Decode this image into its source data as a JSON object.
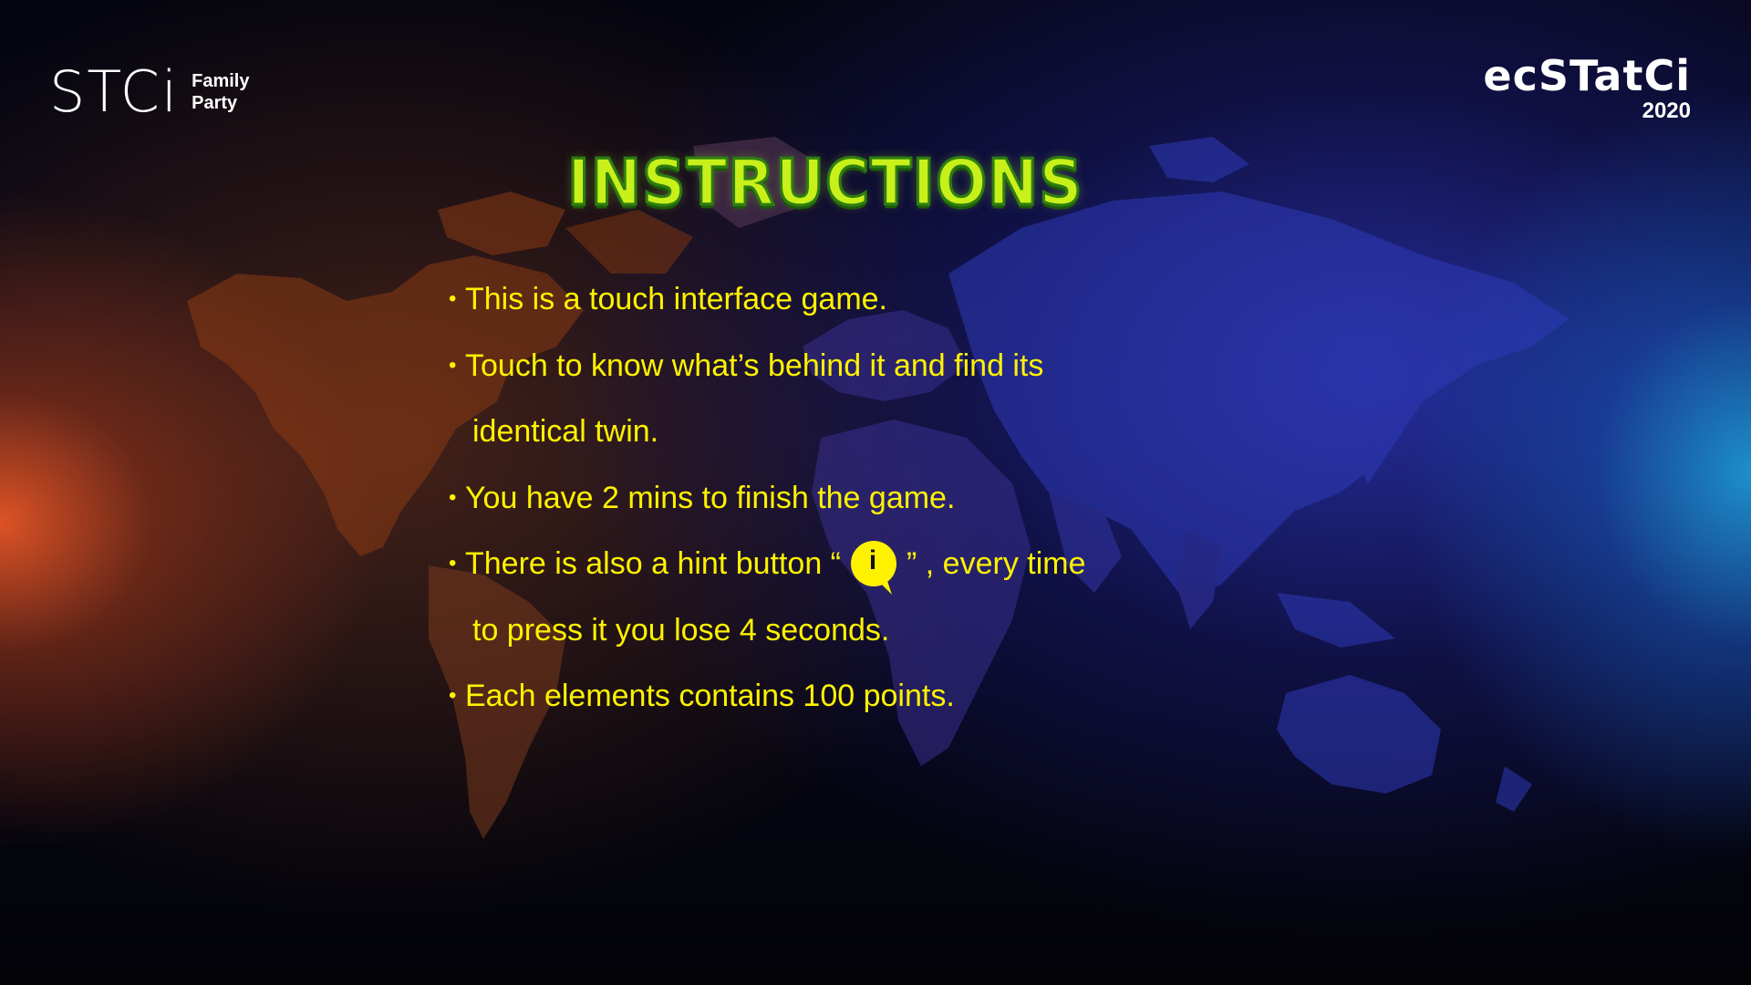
{
  "logos": {
    "stci_mark": "STCi",
    "stci_sub_line1": "Family",
    "stci_sub_line2": "Party",
    "event_name": "ecSTatCi",
    "event_year": "2020"
  },
  "title": "INSTRUCTIONS",
  "instructions": {
    "line1": "This is a touch interface game.",
    "line2": "Touch to know what’s behind it and find its",
    "line3": "identical twin.",
    "line4": "You have 2 mins to finish the game.",
    "line5_before": "There is also a hint button “",
    "hint_icon_label": "i",
    "line5_after": "” , every time",
    "line6": "to press it you lose 4 seconds.",
    "line7": "Each elements contains 100 points."
  },
  "bullet": "•",
  "colors": {
    "text": "#fff200",
    "title_fill": "#c8f01a",
    "title_stroke": "#2e7d12",
    "left_glow": "#e85626",
    "right_glow": "#1e96d2",
    "map_blue": "#2a3ab0"
  },
  "background": {
    "map_icon": "world-map-icon"
  }
}
